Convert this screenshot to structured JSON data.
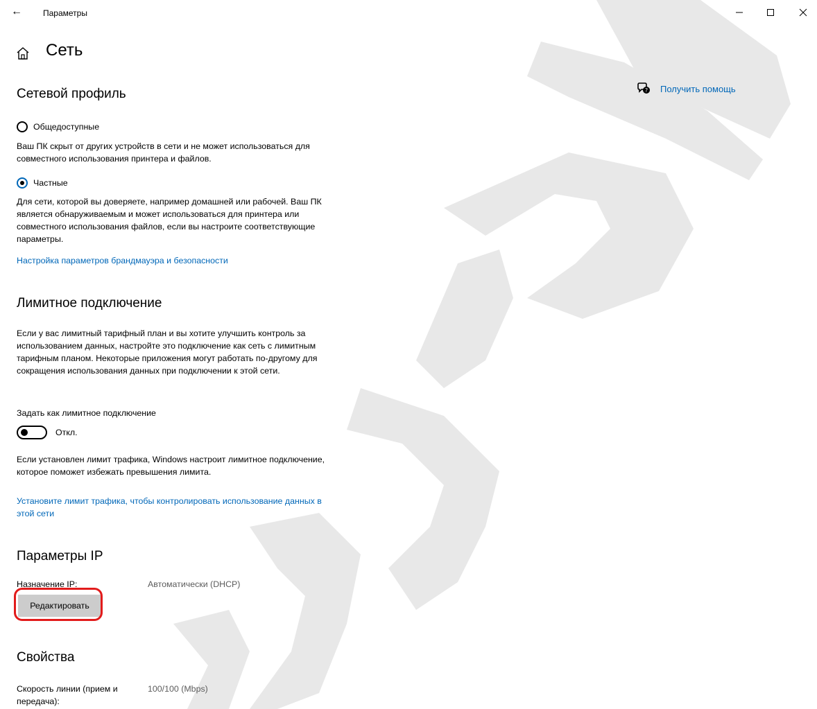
{
  "window": {
    "title": "Параметры"
  },
  "header": {
    "title": "Сеть"
  },
  "help": {
    "label": "Получить помощь"
  },
  "network_profile": {
    "heading": "Сетевой профиль",
    "public": {
      "label": "Общедоступные",
      "selected": false,
      "description": "Ваш ПК скрыт от других устройств в сети и не может использоваться для совместного использования принтера и файлов."
    },
    "private": {
      "label": "Частные",
      "selected": true,
      "description": "Для сети, которой вы доверяете, например домашней или рабочей. Ваш ПК является обнаруживаемым и может использоваться для принтера или совместного использования файлов, если вы настроите соответствующие параметры."
    },
    "firewall_link": "Настройка параметров брандмауэра и безопасности"
  },
  "metered": {
    "heading": "Лимитное подключение",
    "description": "Если у вас лимитный тарифный план и вы хотите улучшить контроль за использованием данных, настройте это подключение как сеть с лимитным тарифным планом. Некоторые приложения могут работать по-другому для сокращения использования данных при подключении к этой сети.",
    "toggle_caption": "Задать как лимитное подключение",
    "toggle_state": "Откл.",
    "limit_note": "Если установлен лимит трафика, Windows настроит лимитное подключение, которое поможет избежать превышения лимита.",
    "limit_link": "Установите лимит трафика, чтобы контролировать использование данных в этой сети"
  },
  "ip_settings": {
    "heading": "Параметры IP",
    "assignment_label": "Назначение IP:",
    "assignment_value": "Автоматически (DHCP)",
    "edit_button": "Редактировать"
  },
  "properties": {
    "heading": "Свойства",
    "link_speed_label": "Скорость линии (прием и передача):",
    "link_speed_value": "100/100 (Mbps)"
  },
  "colors": {
    "accent": "#0067b8",
    "button_bg": "#cccccc",
    "highlight": "#e21b1b",
    "value_text": "#5c5c5c"
  }
}
